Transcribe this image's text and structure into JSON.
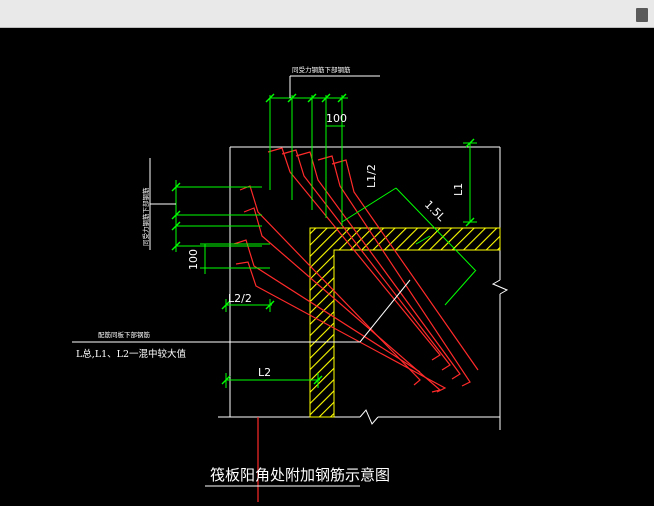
{
  "window": {
    "title": ""
  },
  "diagram": {
    "title": "筏板阳角处附加钢筋示意图",
    "dims": {
      "d100_top": "100",
      "d100_left": "100",
      "l1_half": "L1/2",
      "l1": "L1",
      "l15": "1.5L",
      "l2_half": "L2/2",
      "l2": "L2"
    },
    "callouts": {
      "top_bars": "同受力钢筋下部钢筋",
      "left_bars": "同受力钢筋下部钢筋",
      "bottom_bars": "配筋同板下部钢筋",
      "note": "L总,L1、L2一混中较大值"
    },
    "colors": {
      "background": "#000000",
      "outline": "#ffffff",
      "dimension": "#00ff00",
      "rebar": "#ff2a2a",
      "hatch": "#ffff00",
      "text": "#ffffff"
    }
  }
}
